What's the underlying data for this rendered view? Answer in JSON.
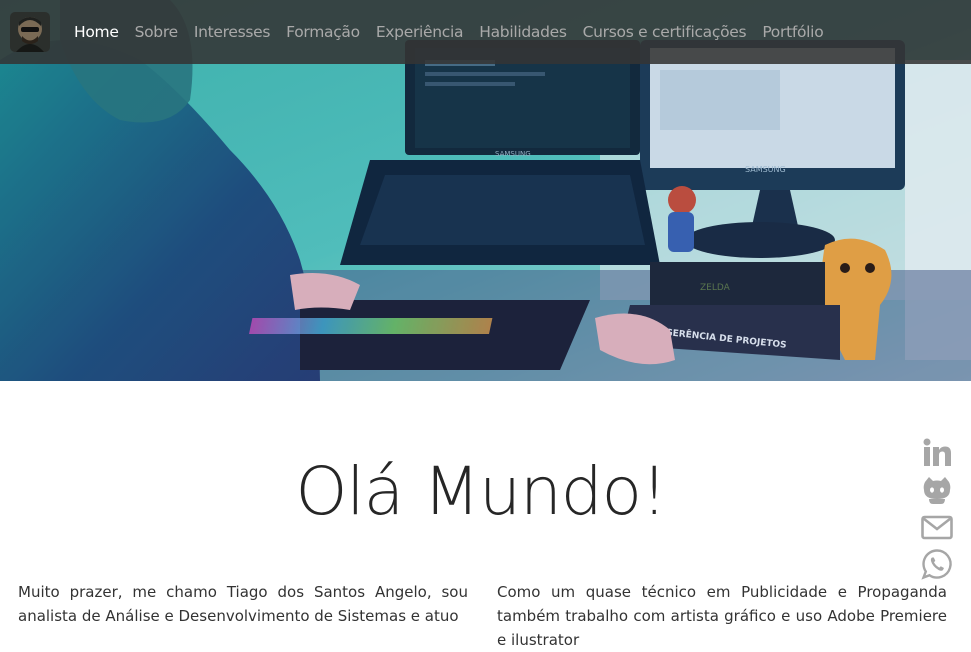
{
  "nav": {
    "items": [
      {
        "label": "Home",
        "active": true
      },
      {
        "label": "Sobre",
        "active": false
      },
      {
        "label": "Interesses",
        "active": false
      },
      {
        "label": "Formação",
        "active": false
      },
      {
        "label": "Experiência",
        "active": false
      },
      {
        "label": "Habilidades",
        "active": false
      },
      {
        "label": "Cursos e certificações",
        "active": false
      },
      {
        "label": "Portfólio",
        "active": false
      }
    ]
  },
  "hero": {
    "monitor_brand": "SAMSUNG",
    "laptop_brand": "SAMSUNG",
    "book_title": "GERÊNCIA DE PROJETOS",
    "game_title": "ZELDA"
  },
  "main": {
    "title": "Olá Mundo!",
    "left_paragraph": "Muito prazer, me chamo Tiago dos Santos Angelo, sou analista de Análise e Desenvolvimento de Sistemas e atuo",
    "right_paragraph": "Como um quase técnico em Publicidade e Propaganda também trabalho com artista gráfico e uso Adobe Premiere e ilustrator"
  },
  "social": {
    "icons": [
      "linkedin-icon",
      "github-icon",
      "email-icon",
      "whatsapp-icon"
    ],
    "color": "#a6a6a6"
  }
}
